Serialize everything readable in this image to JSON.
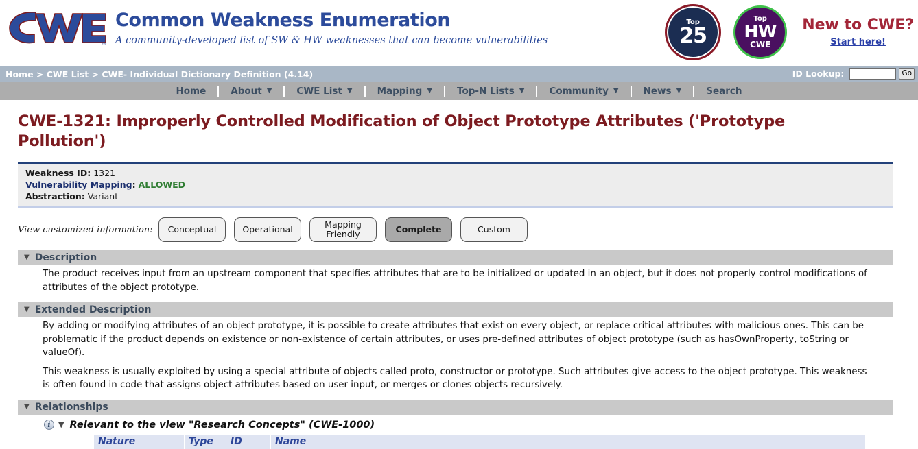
{
  "masthead": {
    "logo_alt": "CWE logo",
    "brand_title": "Common Weakness Enumeration",
    "brand_subtitle": "A community-developed list of SW & HW weaknesses that can become vulnerabilities",
    "badges": [
      {
        "name": "top25",
        "small": "Top",
        "big": "25"
      },
      {
        "name": "tophw",
        "small": "Top",
        "big": "HW",
        "sub": "CWE"
      }
    ],
    "new_to_cwe": "New to CWE?",
    "start_here": "Start here!"
  },
  "breadcrumb": {
    "text": "Home > CWE List > CWE- Individual Dictionary Definition (4.14)",
    "lookup_label": "ID Lookup:",
    "lookup_value": "",
    "lookup_placeholder": "",
    "go_label": "Go"
  },
  "nav": {
    "items": [
      {
        "label": "Home",
        "caret": false
      },
      {
        "label": "About",
        "caret": true
      },
      {
        "label": "CWE List",
        "caret": true
      },
      {
        "label": "Mapping",
        "caret": true
      },
      {
        "label": "Top-N Lists",
        "caret": true
      },
      {
        "label": "Community",
        "caret": true
      },
      {
        "label": "News",
        "caret": true
      },
      {
        "label": "Search",
        "caret": false
      }
    ],
    "caret_glyph": "▼"
  },
  "page": {
    "title": "CWE-1321: Improperly Controlled Modification of Object Prototype Attributes ('Prototype Pollution')"
  },
  "infobox": {
    "weakness_id_key": "Weakness ID:",
    "weakness_id_value": "1321",
    "vuln_mapping_key": "Vulnerability Mapping",
    "vuln_mapping_sep": ":",
    "vuln_mapping_value": "ALLOWED",
    "abstraction_key": "Abstraction:",
    "abstraction_value": "Variant"
  },
  "view_customized": {
    "label": "View customized information:",
    "buttons": [
      {
        "label": "Conceptual",
        "selected": false
      },
      {
        "label": "Operational",
        "selected": false
      },
      {
        "label": "Mapping Friendly",
        "line1": "Mapping",
        "line2": "Friendly",
        "selected": false
      },
      {
        "label": "Complete",
        "selected": true
      },
      {
        "label": "Custom",
        "selected": false
      }
    ]
  },
  "sections": {
    "description": {
      "heading": "Description",
      "paragraphs": [
        "The product receives input from an upstream component that specifies attributes that are to be initialized or updated in an object, but it does not properly control modifications of attributes of the object prototype."
      ]
    },
    "extended_description": {
      "heading": "Extended Description",
      "paragraphs": [
        "By adding or modifying attributes of an object prototype, it is possible to create attributes that exist on every object, or replace critical attributes with malicious ones. This can be problematic if the product depends on existence or non-existence of certain attributes, or uses pre-defined attributes of object prototype (such as hasOwnProperty, toString or valueOf).",
        "This weakness is usually exploited by using a special attribute of objects called proto, constructor or prototype. Such attributes give access to the object prototype. This weakness is often found in code that assigns object attributes based on user input, or merges or clones objects recursively."
      ]
    },
    "relationships": {
      "heading": "Relationships",
      "view_title": "Relevant to the view \"Research Concepts\" (CWE-1000)",
      "info_glyph": "i",
      "table_headers": [
        "Nature",
        "Type",
        "ID",
        "Name"
      ]
    }
  },
  "glyphs": {
    "collapse_caret": "▼"
  },
  "colors": {
    "brand_blue": "#2c4b9b",
    "title_maroon": "#7c1b20",
    "crumb_bar": "#a9b7c6",
    "nav_bar": "#adadad",
    "nav_text": "#3d4f63",
    "section_head": "#c9c9c9",
    "infobox_bg": "#ededed",
    "infobox_top_border": "#23417a",
    "allowed_green": "#2f7d32",
    "table_header_bg": "#dfe4f2",
    "table_header_text": "#2d4699",
    "badge_top25_bg": "#1b2d52",
    "badge_tophw_bg": "#4a1060",
    "new_cwe_red": "#a32638"
  }
}
